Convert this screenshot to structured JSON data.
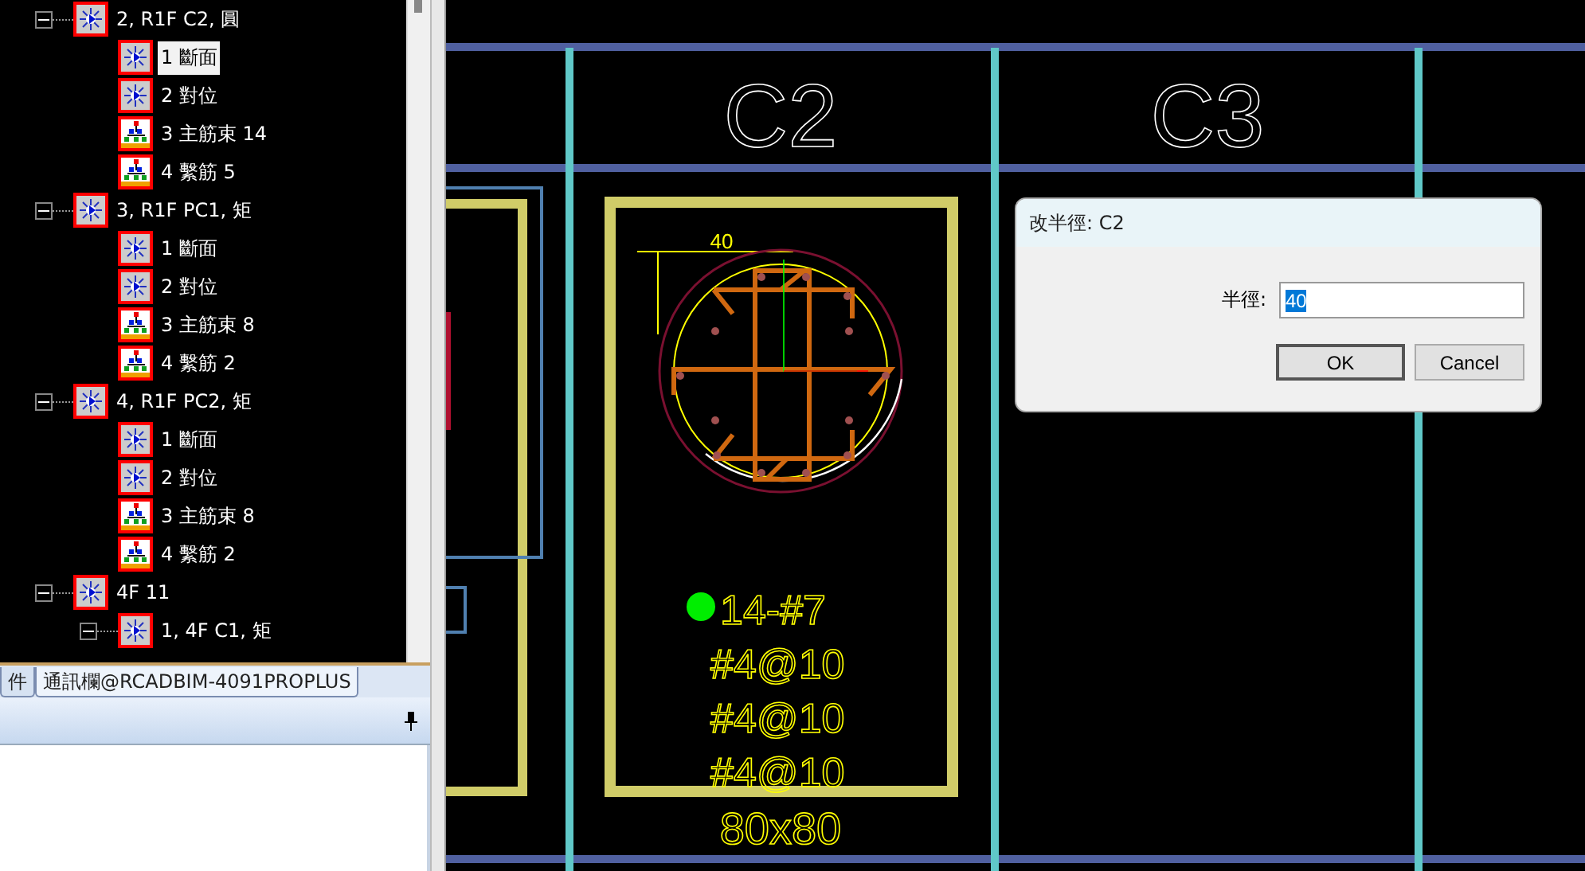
{
  "tree": [
    {
      "children": [
        {
          "label": "2, R1F C2, 圓",
          "kind": "section",
          "expanded": true,
          "selected": false,
          "children": [
            {
              "label": "1 斷面",
              "kind": "section",
              "selected": true
            },
            {
              "label": "2 對位",
              "kind": "section",
              "selected": false
            },
            {
              "label": "3 主筋束 14",
              "kind": "bars",
              "selected": false
            },
            {
              "label": "4 繫筋 5",
              "kind": "bars",
              "selected": false
            }
          ]
        },
        {
          "label": "3, R1F PC1, 矩",
          "kind": "section",
          "expanded": true,
          "selected": false,
          "children": [
            {
              "label": "1 斷面",
              "kind": "section",
              "selected": false
            },
            {
              "label": "2 對位",
              "kind": "section",
              "selected": false
            },
            {
              "label": "3 主筋束 8",
              "kind": "bars",
              "selected": false
            },
            {
              "label": "4 繫筋 2",
              "kind": "bars",
              "selected": false
            }
          ]
        },
        {
          "label": "4, R1F PC2, 矩",
          "kind": "section",
          "expanded": true,
          "selected": false,
          "children": [
            {
              "label": "1 斷面",
              "kind": "section",
              "selected": false
            },
            {
              "label": "2 對位",
              "kind": "section",
              "selected": false
            },
            {
              "label": "3 主筋束 8",
              "kind": "bars",
              "selected": false
            },
            {
              "label": "4 繫筋 2",
              "kind": "bars",
              "selected": false
            }
          ]
        }
      ]
    },
    {
      "label": "4F 11",
      "kind": "section",
      "expanded": true,
      "selected": false,
      "children": [
        {
          "label": "1, 4F C1, 矩",
          "kind": "section",
          "expanded": true,
          "selected": false
        }
      ]
    }
  ],
  "tabs": [
    {
      "label": "件",
      "selected": false
    },
    {
      "label": "通訊欄@RCADBIM-4091PROPLUS",
      "selected": true
    }
  ],
  "drawing": {
    "column_labels": [
      "C2",
      "C3"
    ],
    "dimension": "40",
    "bar_notes": [
      "14-#7",
      "#4@10",
      "#4@10",
      "#4@10"
    ],
    "size": "80x80"
  },
  "dialog": {
    "title": "改半徑: C2",
    "field_label": "半徑:",
    "value": "40",
    "buttons": [
      {
        "label": "OK",
        "default": true
      },
      {
        "label": "Cancel",
        "default": false
      }
    ]
  }
}
